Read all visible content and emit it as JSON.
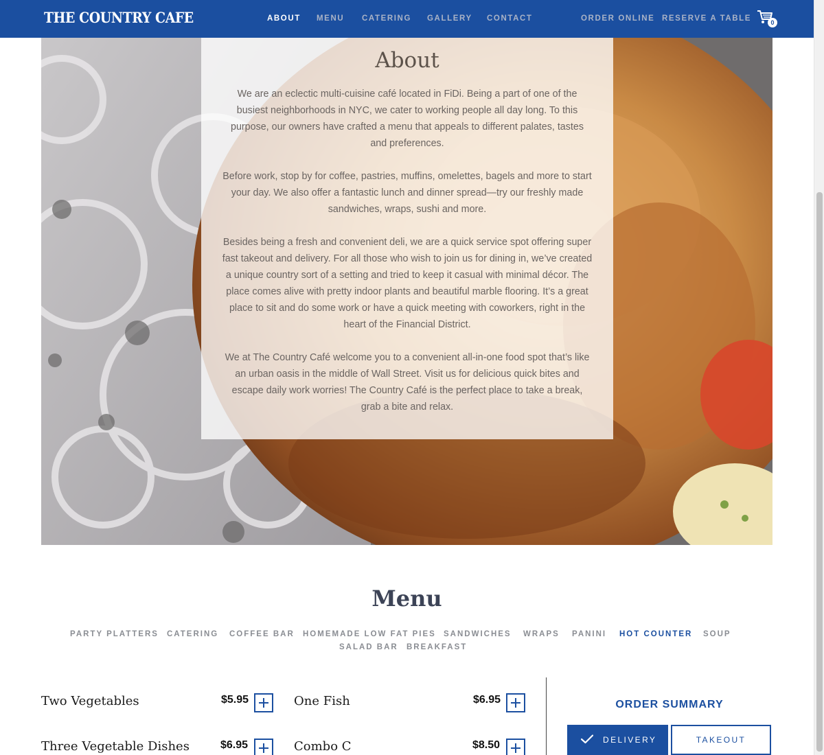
{
  "header": {
    "logo_text": "THE COUNTRY CAFE",
    "nav": [
      "ABOUT",
      "MENU",
      "CATERING",
      "GALLERY",
      "CONTACT"
    ],
    "active_nav": "ABOUT",
    "actions": [
      "ORDER ONLINE",
      "RESERVE A TABLE"
    ],
    "cart_count": "0",
    "cart_icon": "shopping-cart-icon"
  },
  "about": {
    "title": "About",
    "paragraphs": [
      "We are an eclectic multi-cuisine café located in FiDi. Being a part of one of the busiest neighborhoods in NYC, we cater to working people all day long. To this purpose, our owners have crafted a menu that appeals to different palates, tastes and preferences.",
      "Before work, stop by for coffee, pastries, muffins, omelettes, bagels and more to start your day. We also offer a fantastic lunch and dinner spread—try our freshly made sandwiches, wraps, sushi and more.",
      "Besides being a fresh and convenient deli, we are a quick service spot offering super fast takeout and delivery. For all those who wish to join us for dining in, we’ve created a unique country sort of a setting and tried to keep it casual with minimal décor. The place comes alive with pretty indoor plants and beautiful marble flooring. It’s a great place to sit and do some work or have a quick meeting with coworkers, right in the heart of the Financial District.",
      "We at The Country Café welcome you to a convenient all-in-one food spot that’s like an urban oasis in the middle of Wall Street. Visit us for delicious quick bites and escape daily work worries! The Country Café is the perfect place to take a break, grab a bite and relax."
    ]
  },
  "menu": {
    "title": "Menu",
    "categories": [
      "PARTY PLATTERS",
      "CATERING",
      "COFFEE BAR",
      "HOMEMADE LOW FAT PIES",
      "SANDWICHES",
      "WRAPS",
      "PANINI",
      "HOT COUNTER",
      "SOUP",
      "SALAD BAR",
      "BREAKFAST"
    ],
    "active_category": "HOT COUNTER",
    "items": [
      {
        "name": "Two Vegetables",
        "price": "$5.95"
      },
      {
        "name": "One Fish",
        "price": "$6.95"
      },
      {
        "name": "Three Vegetable Dishes",
        "price": "$6.95"
      },
      {
        "name": "Combo C",
        "price": "$8.50"
      }
    ],
    "add_icon": "plus-icon"
  },
  "order_summary": {
    "title": "ORDER SUMMARY",
    "modes": [
      "DELIVERY",
      "TAKEOUT"
    ],
    "selected_mode": "DELIVERY",
    "check_icon": "check-icon"
  },
  "colors": {
    "brand_blue": "#1b4fa0",
    "nav_inactive": "#aab3c6",
    "category_inactive": "#8a8d93"
  }
}
